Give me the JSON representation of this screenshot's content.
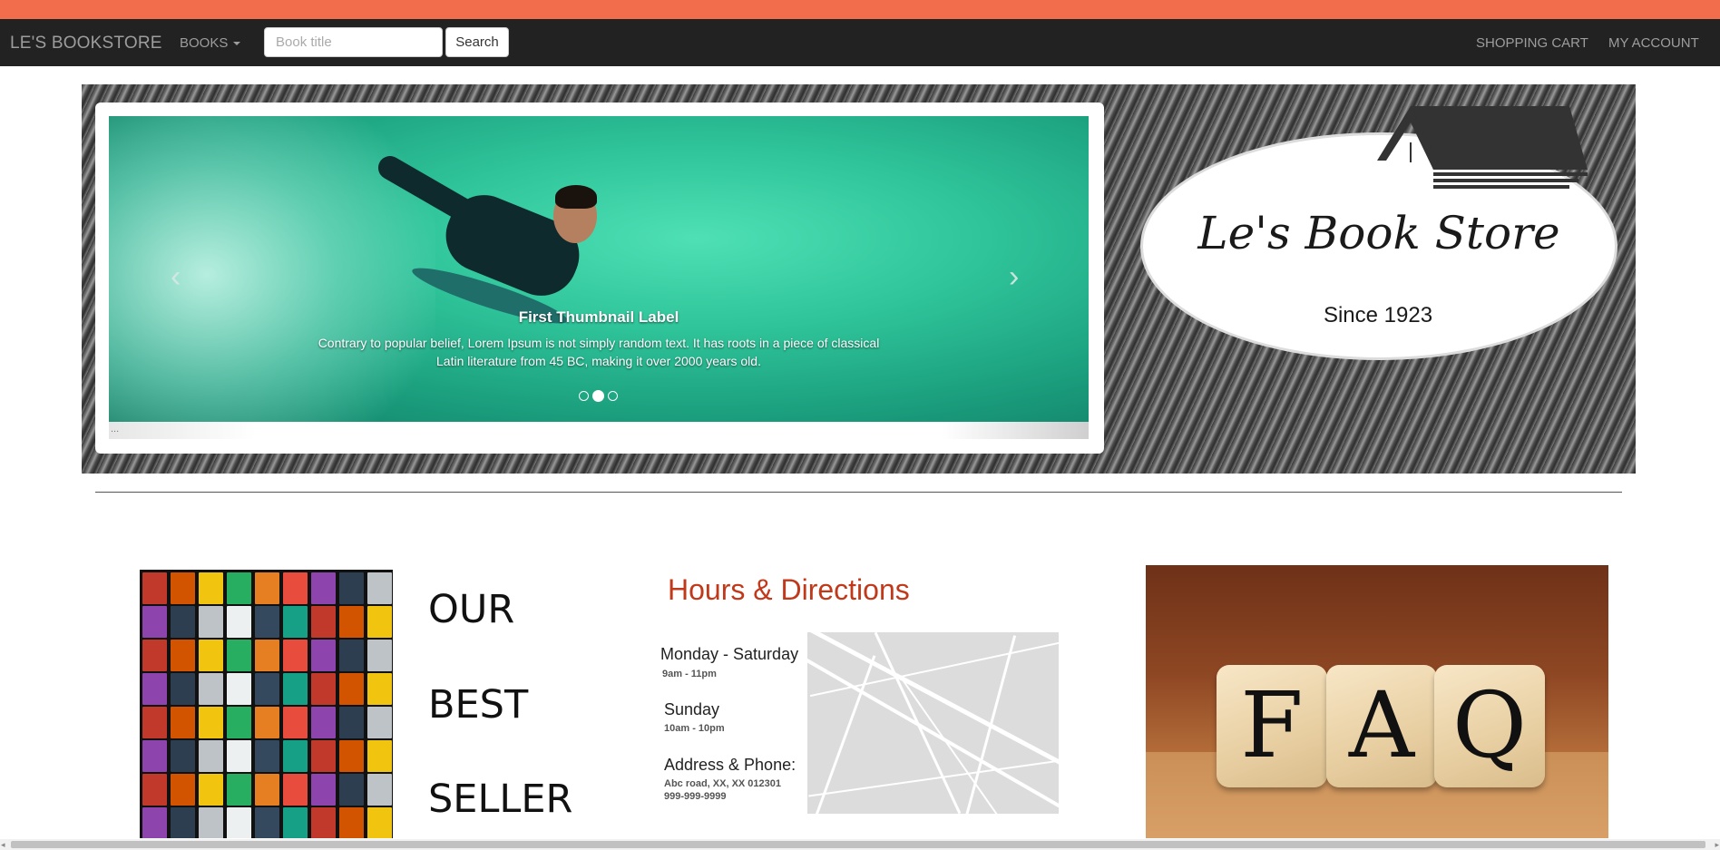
{
  "navbar": {
    "brand": "LE'S BOOKSTORE",
    "books_menu": "BOOKS",
    "search_placeholder": "Book title",
    "search_button": "Search",
    "shopping_cart": "SHOPPING CART",
    "my_account": "MY ACCOUNT"
  },
  "carousel": {
    "caption_title": "First Thumbnail Label",
    "caption_text": "Contrary to popular belief, Lorem Ipsum is not simply random text. It has roots in a piece of classical Latin literature from 45 BC, making it over 2000 years old.",
    "prev_arrow": "‹",
    "next_arrow": "›",
    "active_index": 1,
    "slide_count": 3,
    "thumb_text": "..."
  },
  "logo": {
    "name": "Le's Book Store",
    "since": "Since 1923"
  },
  "bestseller": {
    "words": [
      "OUR",
      "BEST",
      "SELLER"
    ]
  },
  "hours": {
    "title": "Hours & Directions",
    "weekday_label": "Monday - Saturday",
    "weekday_hours": "9am - 11pm",
    "sunday_label": "Sunday",
    "sunday_hours": "10am - 10pm",
    "address_label": "Address & Phone:",
    "address": "Abc road, XX, XX 012301",
    "phone": "999-999-9999"
  },
  "faq": {
    "letters": [
      "F",
      "A",
      "Q"
    ]
  },
  "scrollbar": {
    "left_arrow": "◂",
    "right_arrow": "▸"
  },
  "colors": {
    "accent_stripe": "#f26d4b",
    "navbar_bg": "#222222",
    "hours_title": "#c0391b"
  }
}
